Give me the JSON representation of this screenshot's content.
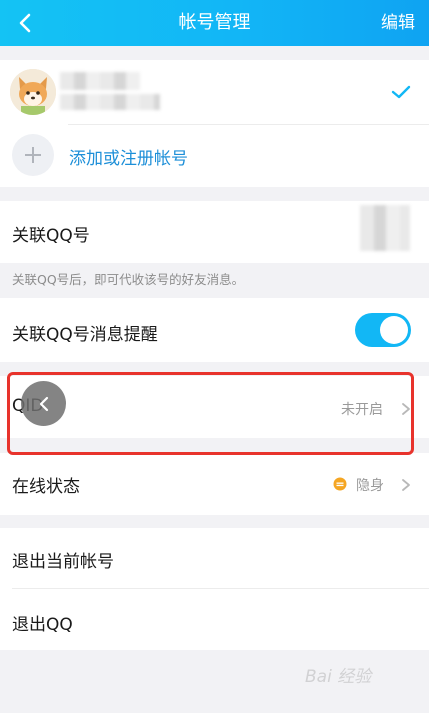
{
  "header": {
    "title": "帐号管理",
    "edit_label": "编辑"
  },
  "accounts": {
    "add_label": "添加或注册帐号"
  },
  "linked_qq": {
    "label": "关联QQ号",
    "hint": "关联QQ号后，即可代收该号的好友消息。"
  },
  "linked_reminder": {
    "label": "关联QQ号消息提醒",
    "enabled": true
  },
  "qid": {
    "label": "QID",
    "value": "未开启"
  },
  "online_status": {
    "label": "在线状态",
    "value": "隐身"
  },
  "actions": {
    "logout_current": "退出当前帐号",
    "exit_qq": "退出QQ"
  },
  "watermark": "Bai 经验",
  "colors": {
    "accent": "#12b7f5",
    "highlight": "#e8332c",
    "status_dot": "#f5a623"
  }
}
